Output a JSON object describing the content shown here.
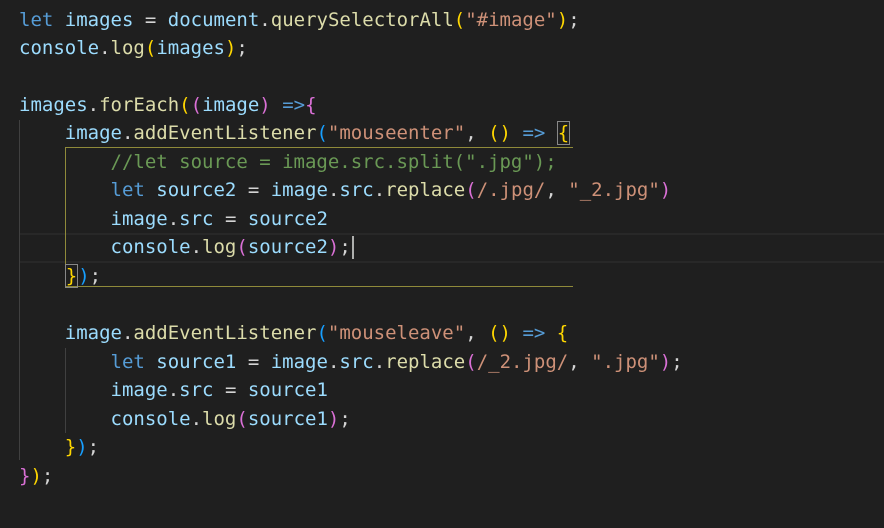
{
  "code": {
    "l1": [
      "let",
      "images",
      "=",
      "document",
      ".",
      "querySelectorAll",
      "(",
      "\"#image\"",
      ")",
      ";"
    ],
    "l2": [
      "console",
      ".",
      "log",
      "(",
      "images",
      ")",
      ";"
    ],
    "l4": [
      "images",
      ".",
      "forEach",
      "(",
      "(",
      "image",
      ")",
      "=>",
      "{"
    ],
    "l5": [
      "image",
      ".",
      "addEventListener",
      "(",
      "\"mouseenter\"",
      ",",
      "(",
      ")",
      "=>",
      "{"
    ],
    "l6": [
      "//let source = image.src.split(\".jpg\");"
    ],
    "l7": [
      "let",
      "source2",
      "=",
      "image",
      ".",
      "src",
      ".",
      "replace",
      "(",
      "/.jpg/",
      ",",
      "\"_2.jpg\"",
      ")"
    ],
    "l8": [
      "image",
      ".",
      "src",
      "=",
      "source2"
    ],
    "l9": [
      "console",
      ".",
      "log",
      "(",
      "source2",
      ")",
      ";"
    ],
    "l10": [
      "}",
      ")",
      ";"
    ],
    "l12": [
      "image",
      ".",
      "addEventListener",
      "(",
      "\"mouseleave\"",
      ",",
      "(",
      ")",
      "=>",
      "{"
    ],
    "l13": [
      "let",
      "source1",
      "=",
      "image",
      ".",
      "src",
      ".",
      "replace",
      "(",
      "/_2.jpg/",
      ",",
      "\".jpg\"",
      ")",
      ";"
    ],
    "l14": [
      "image",
      ".",
      "src",
      "=",
      "source1"
    ],
    "l15": [
      "console",
      ".",
      "log",
      "(",
      "source1",
      ")",
      ";"
    ],
    "l16": [
      "}",
      ")",
      ";"
    ],
    "l17": [
      "}",
      ")",
      ";"
    ]
  }
}
